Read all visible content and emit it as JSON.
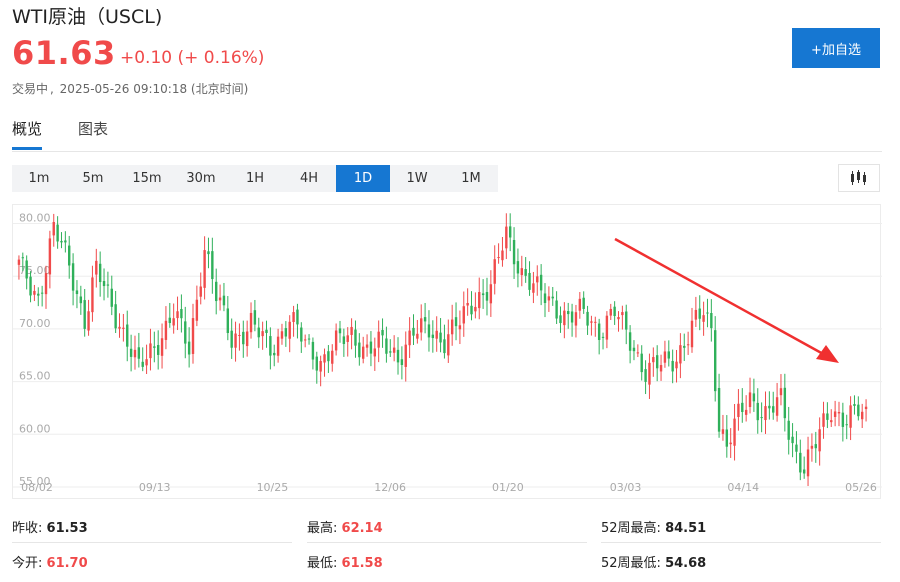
{
  "quote": {
    "title": "WTI原油（USCL)",
    "price": "61.63",
    "change": "+0.10 (+ 0.16%)",
    "status": "交易中",
    "timestamp": "2025-05-26 09:10:18 (北京时间)",
    "add_button": "+加自选"
  },
  "tabs": [
    {
      "label": "概览",
      "active": true
    },
    {
      "label": "图表",
      "active": false
    }
  ],
  "periods": [
    {
      "label": "1m",
      "active": false
    },
    {
      "label": "5m",
      "active": false
    },
    {
      "label": "15m",
      "active": false
    },
    {
      "label": "30m",
      "active": false
    },
    {
      "label": "1H",
      "active": false
    },
    {
      "label": "4H",
      "active": false
    },
    {
      "label": "1D",
      "active": true
    },
    {
      "label": "1W",
      "active": false
    },
    {
      "label": "1M",
      "active": false
    }
  ],
  "chart_type_icon": "candlestick-icon",
  "colors": {
    "up": "#f04a4a",
    "down": "#2fb05a",
    "accent": "#1677d2",
    "annotation_arrow": "#f03030"
  },
  "chart_data": {
    "type": "candlestick",
    "y_ticks": [
      "80.00",
      "75.00",
      "70.00",
      "65.00",
      "60.00",
      "55.00"
    ],
    "x_labels": [
      "08/02",
      "09/13",
      "10/25",
      "12/06",
      "01/20",
      "03/03",
      "04/14",
      "05/26"
    ],
    "ylim": [
      55,
      81
    ],
    "grid": true,
    "anchors": [
      [
        0,
        76
      ],
      [
        3,
        74
      ],
      [
        5,
        73
      ],
      [
        9,
        79.5
      ],
      [
        13,
        76
      ],
      [
        17,
        71
      ],
      [
        20,
        75.5
      ],
      [
        23,
        73
      ],
      [
        28,
        69
      ],
      [
        31,
        66
      ],
      [
        36,
        69
      ],
      [
        40,
        71.5
      ],
      [
        44,
        68
      ],
      [
        48,
        78
      ],
      [
        51,
        73
      ],
      [
        55,
        69
      ],
      [
        60,
        70.5
      ],
      [
        65,
        68
      ],
      [
        70,
        71
      ],
      [
        74,
        68.5
      ],
      [
        78,
        67
      ],
      [
        82,
        68.5
      ],
      [
        86,
        69.5
      ],
      [
        90,
        68
      ],
      [
        94,
        68.5
      ],
      [
        98,
        67.5
      ],
      [
        102,
        69.5
      ],
      [
        106,
        70
      ],
      [
        110,
        69
      ],
      [
        114,
        70.5
      ],
      [
        118,
        73
      ],
      [
        122,
        74
      ],
      [
        126,
        79
      ],
      [
        130,
        75.5
      ],
      [
        134,
        73.5
      ],
      [
        138,
        72.5
      ],
      [
        142,
        71
      ],
      [
        146,
        71.5
      ],
      [
        150,
        70
      ],
      [
        154,
        71.5
      ],
      [
        158,
        69
      ],
      [
        162,
        66
      ],
      [
        166,
        66.5
      ],
      [
        170,
        67.5
      ],
      [
        174,
        70
      ],
      [
        177,
        71.5
      ],
      [
        179,
        70
      ],
      [
        181,
        61
      ],
      [
        183,
        59
      ],
      [
        186,
        61.5
      ],
      [
        189,
        63.5
      ],
      [
        193,
        62
      ],
      [
        197,
        63
      ],
      [
        200,
        59
      ],
      [
        203,
        57
      ],
      [
        206,
        59
      ],
      [
        210,
        62.5
      ],
      [
        214,
        61.5
      ],
      [
        217,
        62
      ],
      [
        219,
        61.6
      ]
    ],
    "annotation": "downtrend-arrow"
  },
  "stats": {
    "prev_close_label": "昨收:",
    "prev_close_value": "61.53",
    "high_label": "最高:",
    "high_value": "62.14",
    "high52_label": "52周最高:",
    "high52_value": "84.51",
    "open_label": "今开:",
    "open_value": "61.70",
    "low_label": "最低:",
    "low_value": "61.58",
    "low52_label": "52周最低:",
    "low52_value": "54.68"
  }
}
